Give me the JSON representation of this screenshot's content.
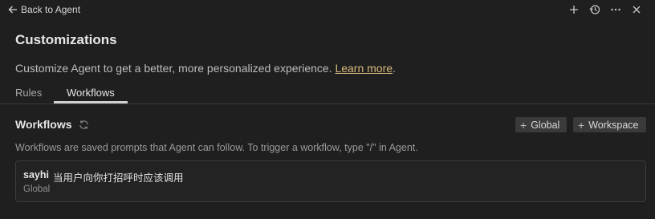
{
  "topbar": {
    "back_label": "Back to Agent",
    "icons": [
      "arrow-left-icon",
      "plus-icon",
      "history-icon",
      "more-icon",
      "close-icon"
    ]
  },
  "header": {
    "title": "Customizations",
    "subtitle_text": "Customize Agent to get a better, more personalized experience. ",
    "learn_more": "Learn more",
    "subtitle_end": "."
  },
  "tabs": [
    {
      "label": "Rules",
      "active": false
    },
    {
      "label": "Workflows",
      "active": true
    }
  ],
  "workflows": {
    "title": "Workflows",
    "add_global": "Global",
    "add_workspace": "Workspace",
    "description": "Workflows are saved prompts that Agent can follow. To trigger a workflow, type \"/\" in Agent.",
    "items": [
      {
        "name": "sayhi",
        "description": "当用户向你打招呼时应该调用",
        "scope": "Global"
      }
    ]
  },
  "colors": {
    "background": "#1f1f1f",
    "link": "#d7ba7d",
    "button_bg": "#3a3a3a",
    "card_border": "#3c3c3c"
  }
}
